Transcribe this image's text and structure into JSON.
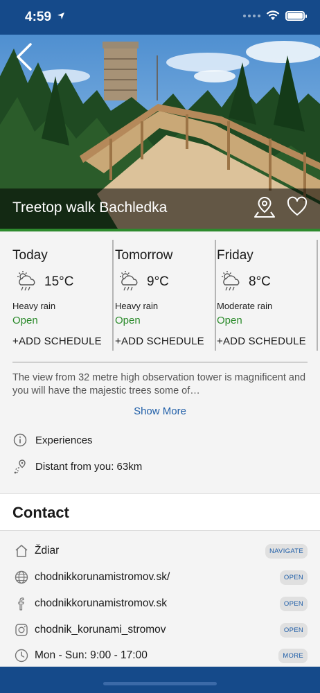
{
  "status_bar": {
    "time": "4:59"
  },
  "hero": {
    "title": "Treetop walk Bachledka"
  },
  "weather": [
    {
      "day": "Today",
      "temp": "15°C",
      "condition": "Heavy rain",
      "status": "Open",
      "add_label": "+ADD SCHEDULE"
    },
    {
      "day": "Tomorrow",
      "temp": "9°C",
      "condition": "Heavy rain",
      "status": "Open",
      "add_label": "+ADD SCHEDULE"
    },
    {
      "day": "Friday",
      "temp": "8°C",
      "condition": "Moderate rain",
      "status": "Open",
      "add_label": "+ADD SCHEDULE"
    }
  ],
  "description": {
    "text": "The view from 32 metre high observation tower is magnificent and you will have the majestic trees some of…",
    "show_more": "Show More"
  },
  "info": {
    "experiences": "Experiences",
    "distance": "Distant from you: 63km"
  },
  "contact": {
    "title": "Contact",
    "rows": [
      {
        "icon": "home-icon",
        "text": "Ždiar",
        "action": "NAVIGATE"
      },
      {
        "icon": "globe-icon",
        "text": "chodnikkorunamistromov.sk/",
        "action": "OPEN"
      },
      {
        "icon": "facebook-icon",
        "text": "chodnikkorunamistromov.sk",
        "action": "OPEN"
      },
      {
        "icon": "instagram-icon",
        "text": "chodnik_korunami_stromov",
        "action": "OPEN"
      },
      {
        "icon": "clock-icon",
        "text": "Mon - Sun: 9:00 - 17:00",
        "action": "MORE"
      }
    ]
  },
  "colors": {
    "brand": "#154a8a",
    "accent_green": "#2e8b2e",
    "link_blue": "#1f5ea8"
  }
}
